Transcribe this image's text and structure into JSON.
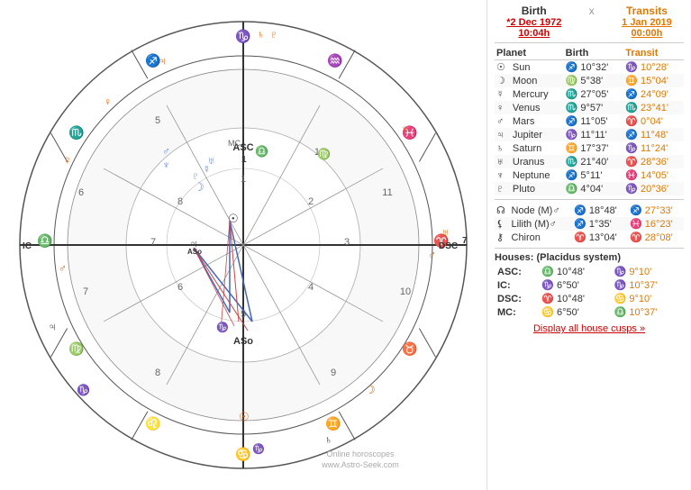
{
  "header": {
    "birth_label": "Birth",
    "x_label": "x",
    "transits_label": "Transits",
    "birth_date": "*2 Dec 1972",
    "birth_time": "10:04h",
    "transit_date": "1 Jan 2019",
    "transit_time": "00:00h"
  },
  "table": {
    "col_planet": "Planet",
    "col_birth": "Birth",
    "col_transit": "Transit",
    "rows": [
      {
        "symbol": "☉",
        "name": "Sun",
        "birth": "♐ 10°32'",
        "transit": "♑ 10°28'"
      },
      {
        "symbol": "☽",
        "name": "Moon",
        "birth": "♍ 5°38'",
        "transit": "♊ 15°04'"
      },
      {
        "symbol": "☿",
        "name": "Mercury",
        "birth": "♏ 27°05'",
        "transit": "♐ 24°09'"
      },
      {
        "symbol": "♀",
        "name": "Venus",
        "birth": "♏ 9°57'",
        "transit": "♏ 23°41'"
      },
      {
        "symbol": "♂",
        "name": "Mars",
        "birth": "♐ 11°05'",
        "transit": "♈ 0°04'"
      },
      {
        "symbol": "♃",
        "name": "Jupiter",
        "birth": "♑ 11°11'",
        "transit": "♐ 11°48'"
      },
      {
        "symbol": "♄",
        "name": "Saturn",
        "birth": "♊ 17°37'",
        "transit": "♑ 11°24'"
      },
      {
        "symbol": "♅",
        "name": "Uranus",
        "birth": "♏ 21°40'",
        "transit": "♈ 28°36'"
      },
      {
        "symbol": "♆",
        "name": "Neptune",
        "birth": "♐ 5°11'",
        "transit": "♓ 14°05'"
      },
      {
        "symbol": "♇",
        "name": "Pluto",
        "birth": "♎ 4°04'",
        "transit": "♑ 20°36'"
      }
    ],
    "extra_rows": [
      {
        "symbol": "☊",
        "name": "Node (M)♂",
        "birth": "♐ 18°48'",
        "transit": "♐ 27°33'"
      },
      {
        "symbol": "⚸",
        "name": "Lilith (M)♂",
        "birth": "♐ 1°35'",
        "transit": "♓ 16°23'"
      },
      {
        "symbol": "⚷",
        "name": "Chiron",
        "birth": "♈ 13°04'",
        "transit": "♈ 28°08'"
      }
    ]
  },
  "houses": {
    "title": "Houses: (Placidus system)",
    "rows": [
      {
        "label": "ASC:",
        "birth": "♎ 10°48'",
        "transit": "♑ 9°10'"
      },
      {
        "label": "IC:",
        "birth": "♑ 6°50'",
        "transit": "♑ 10°37'"
      },
      {
        "label": "DSC:",
        "birth": "♈ 10°48'",
        "transit": "♋ 9°10'"
      },
      {
        "label": "MC:",
        "birth": "♋ 6°50'",
        "transit": "♎ 10°37'"
      }
    ]
  },
  "display_link": "Display all house cusps »",
  "watermark": {
    "line1": "Online horoscopes",
    "line2": "www.Astro-Seek.com"
  },
  "chart": {
    "outer_ring": "zodiac wheel",
    "center_label_asc": "ASC",
    "center_label_dsc": "DSC",
    "center_label_mc": "MC",
    "center_label_ic": "IC"
  }
}
